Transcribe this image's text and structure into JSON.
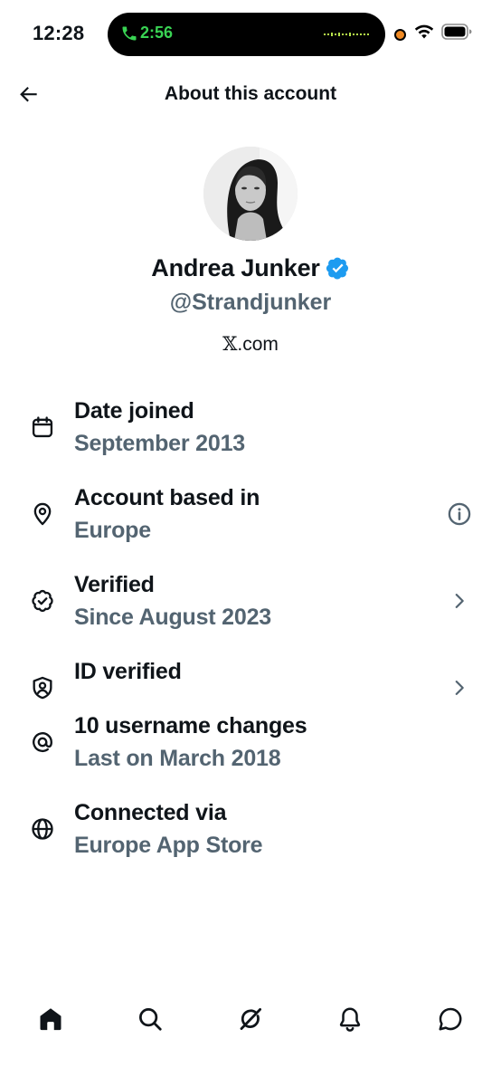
{
  "status_bar": {
    "time": "12:28",
    "call_time": "2:56",
    "call_color": "#39d353"
  },
  "header": {
    "title": "About this account",
    "back_icon": "arrow-left-icon"
  },
  "profile": {
    "display_name": "Andrea Junker",
    "handle": "@Strandjunker",
    "source_prefix": "𝕏",
    "source_suffix": ".com",
    "verified_color": "#1d9bf0"
  },
  "info_rows": [
    {
      "icon": "calendar-icon",
      "title": "Date joined",
      "subtitle": "September 2013",
      "action": null
    },
    {
      "icon": "location-pin-icon",
      "title": "Account based in",
      "subtitle": "Europe",
      "action": "info-icon"
    },
    {
      "icon": "verified-badge-outline-icon",
      "title": "Verified",
      "subtitle": "Since August 2023",
      "action": "chevron-right-icon"
    },
    {
      "icon": "id-shield-icon",
      "title": "ID verified",
      "subtitle": "",
      "action": "chevron-right-icon"
    },
    {
      "icon": "at-sign-icon",
      "title": "10 username changes",
      "subtitle": "Last on March 2018",
      "action": null
    },
    {
      "icon": "globe-icon",
      "title": "Connected via",
      "subtitle": "Europe App Store",
      "action": null
    }
  ],
  "tab_bar": {
    "tabs": [
      "home-icon",
      "search-icon",
      "grok-icon",
      "notifications-bell-icon",
      "messages-icon"
    ],
    "active": "home-icon"
  },
  "colors": {
    "text_primary": "#0f1419",
    "text_secondary": "#536471",
    "background": "#ffffff"
  }
}
